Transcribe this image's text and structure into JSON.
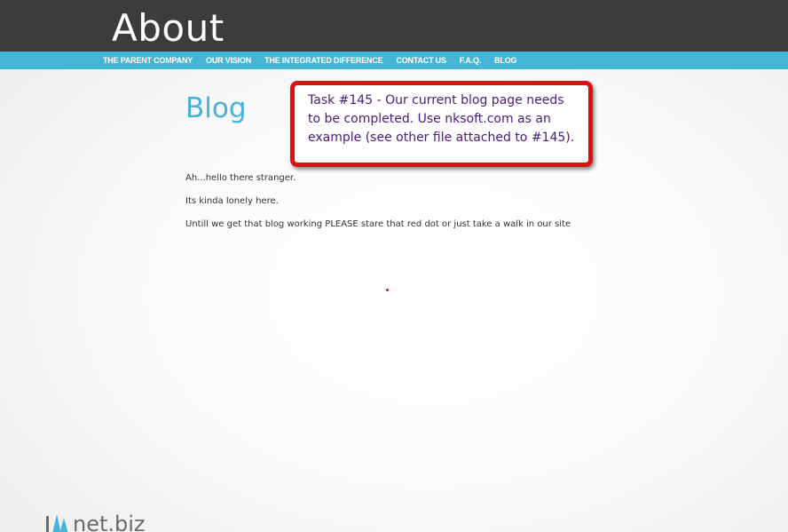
{
  "header": {
    "title": "About"
  },
  "nav": {
    "items": [
      "THE PARENT COMPANY",
      "OUR VISION",
      "THE INTEGRATED DIFFERENCE",
      "CONTACT US",
      "F.A.Q.",
      "BLOG"
    ]
  },
  "page": {
    "heading": "Blog",
    "paragraphs": [
      "Ah...hello there stranger.",
      "Its kinda lonely here.",
      "Untill we get that blog working PLEASE stare that red dot or just take a walk in our site"
    ]
  },
  "callout": {
    "text": "Task #145 - Our current blog page needs to be completed. Use nksoft.com as an example (see other file attached to #145)."
  },
  "footer": {
    "logo_text": "net.biz"
  },
  "colors": {
    "header_bg": "#3c3c3c",
    "nav_bg": "#45b5d6",
    "accent": "#45b2d8",
    "callout_border": "#e01010",
    "callout_text": "#4a1a7a",
    "red_dot": "#d81010"
  },
  "icons": {
    "logo_mark": "logo-mark-icon"
  }
}
